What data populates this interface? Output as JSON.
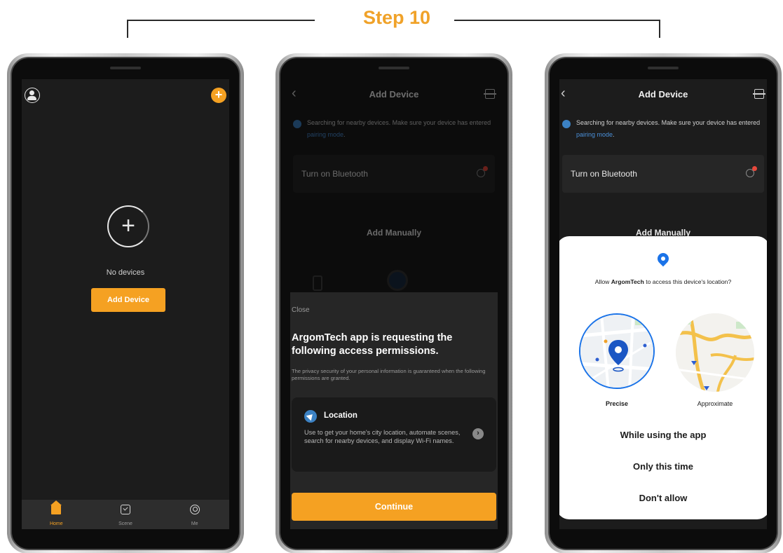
{
  "step": {
    "title": "Step 10"
  },
  "phone1": {
    "no_devices": "No devices",
    "add_device_button": "Add Device",
    "tabs": [
      {
        "label": "Home",
        "icon": "home-icon",
        "active": true
      },
      {
        "label": "Scene",
        "icon": "scene-icon",
        "active": false
      },
      {
        "label": "Me",
        "icon": "me-icon",
        "active": false
      }
    ]
  },
  "add_device_screen": {
    "back": "‹",
    "title": "Add Device",
    "search_text": "Searching for nearby devices. Make sure your device has entered ",
    "pairing_link": "pairing mode",
    "search_text_end": ".",
    "bluetooth_label": "Turn on Bluetooth",
    "add_manually": "Add Manually"
  },
  "phone2": {
    "close": "Close",
    "heading": "ArgomTech app is requesting the following access permissions.",
    "privacy": "The privacy security of your personal information is guaranteed when the following permissions are granted.",
    "permission_title": "Location",
    "permission_desc": "Use to get your home's city location, automate scenes, search for nearby devices, and display Wi-Fi names.",
    "continue_button": "Continue"
  },
  "phone3": {
    "question_prefix": "Allow ",
    "app_name": "ArgomTech",
    "question_suffix": " to access this device's location?",
    "precise_label": "Precise",
    "approximate_label": "Approximate",
    "option_while_using": "While using the app",
    "option_only_this_time": "Only this time",
    "option_dont_allow": "Don't allow"
  },
  "colors": {
    "accent": "#f5a122",
    "link": "#4a8fd8",
    "dialog_blue": "#1a73e8",
    "screen_bg": "#1c1c1c"
  }
}
